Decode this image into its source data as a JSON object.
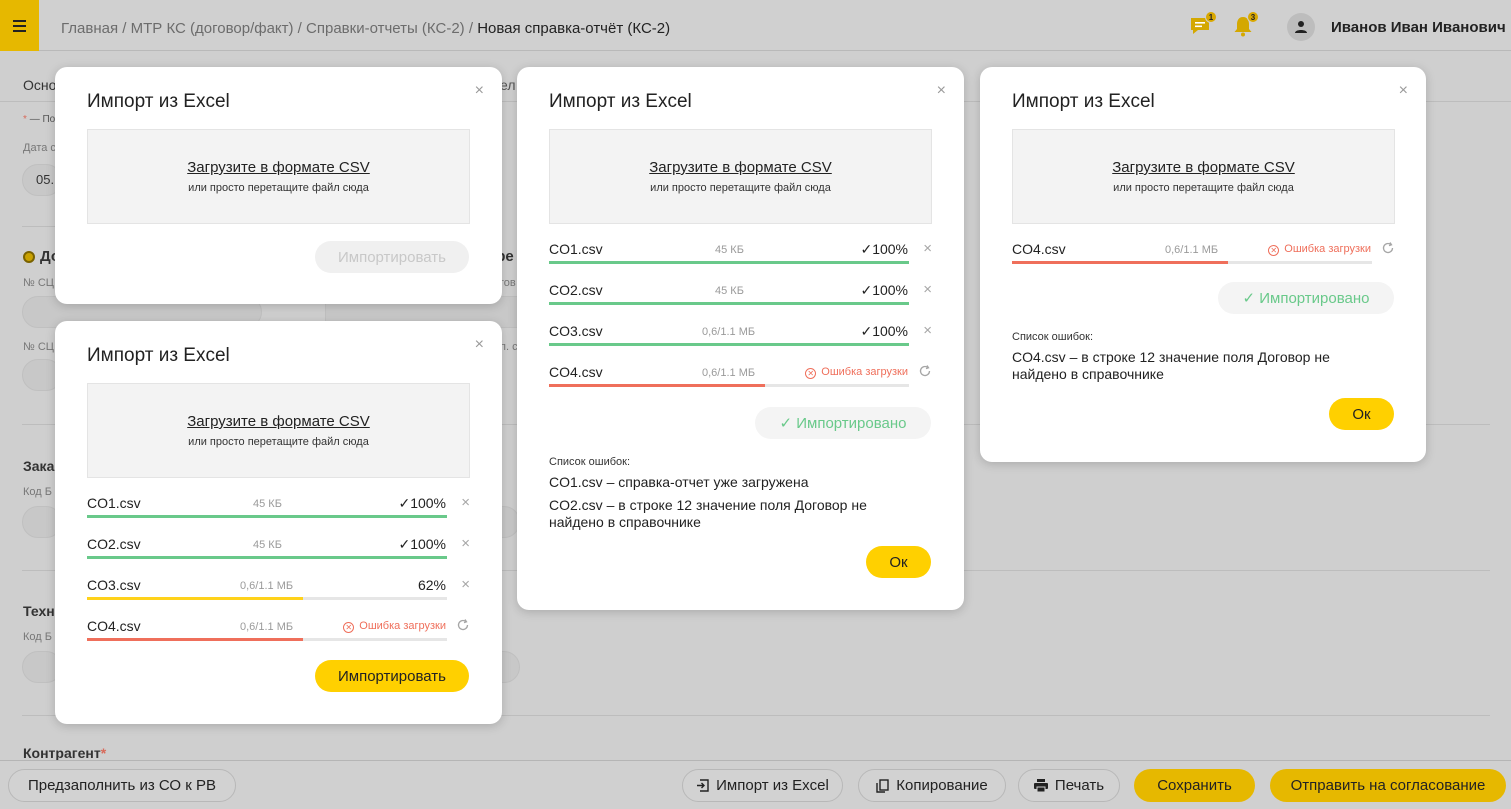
{
  "header": {
    "breadcrumb": {
      "home": "Главная",
      "sep": " / ",
      "level1": "МТР КС (договор/факт)",
      "level2": "Справки-отчеты (КС-2)",
      "current": "Новая справка-отчёт (КС-2)"
    },
    "messages_badge": "1",
    "notifications_badge": "3",
    "user_name": "Иванов Иван Иванович"
  },
  "background": {
    "tab_partial": "Осно",
    "tab_partial2": "ел",
    "required_note": "— По",
    "date_label": "Дата с",
    "date_value": "05.",
    "radio_label": "До",
    "section_right": "гре",
    "num1_label": "№ СЦ",
    "num1_right": "гов",
    "num2_label": "№ СЦ",
    "num2_right": "п. с",
    "customer_head": "Зака",
    "customer_code": "Код Б",
    "tech_head": "Техн",
    "tech_code": "Код Б",
    "contractor_head": "Контрагент",
    "required_star": "*"
  },
  "bottom_bar": {
    "prefill": "Предзаполнить из СО к РВ",
    "import_excel": "Импорт из Excel",
    "copy": "Копирование",
    "print": "Печать",
    "save": "Сохранить",
    "send": "Отправить на согласование"
  },
  "dialog": {
    "title": "Импорт из Excel",
    "close": "×",
    "upload_link": "Загрузите в формате CSV",
    "upload_hint": "или просто перетащите файл сюда",
    "import_button": "Импортировать",
    "imported_button": "Импортировано",
    "check": "✓",
    "ok_button": "Ок",
    "errors_title": "Список ошибок:"
  },
  "dialog_b": {
    "files": [
      {
        "name": "CO1.csv",
        "size": "45 КБ",
        "status": "100%",
        "state": "done",
        "progress": 1.0
      },
      {
        "name": "CO2.csv",
        "size": "45 КБ",
        "status": "100%",
        "state": "done",
        "progress": 1.0
      },
      {
        "name": "CO3.csv",
        "size": "0,6/1.1 МБ",
        "status": "62%",
        "state": "loading",
        "progress": 0.6
      },
      {
        "name": "CO4.csv",
        "size": "0,6/1.1 МБ",
        "status": "Ошибка загрузки",
        "state": "error",
        "progress": 0.6
      }
    ]
  },
  "dialog_c": {
    "files": [
      {
        "name": "CO1.csv",
        "size": "45 КБ",
        "status": "100%",
        "state": "done",
        "progress": 1.0
      },
      {
        "name": "CO2.csv",
        "size": "45 КБ",
        "status": "100%",
        "state": "done",
        "progress": 1.0
      },
      {
        "name": "CO3.csv",
        "size": "0,6/1.1 МБ",
        "status": "100%",
        "state": "done",
        "progress": 1.0
      },
      {
        "name": "CO4.csv",
        "size": "0,6/1.1 МБ",
        "status": "Ошибка загрузки",
        "state": "error",
        "progress": 0.6
      }
    ],
    "errors": [
      "CO1.csv – справка-отчет уже загружена",
      "CO2.csv – в строке 12 значение поля Договор не найдено в справочнике"
    ]
  },
  "dialog_d": {
    "files": [
      {
        "name": "CO4.csv",
        "size": "0,6/1.1 МБ",
        "status": "Ошибка загрузки",
        "state": "error",
        "progress": 0.6
      }
    ],
    "errors": [
      "CO4.csv – в строке 12 значение поля Договор не найдено в справочнике"
    ]
  },
  "colors": {
    "accent": "#ffd000",
    "success": "#69c98a",
    "error": "#ef6f5b",
    "progress": "#ffd21a"
  }
}
